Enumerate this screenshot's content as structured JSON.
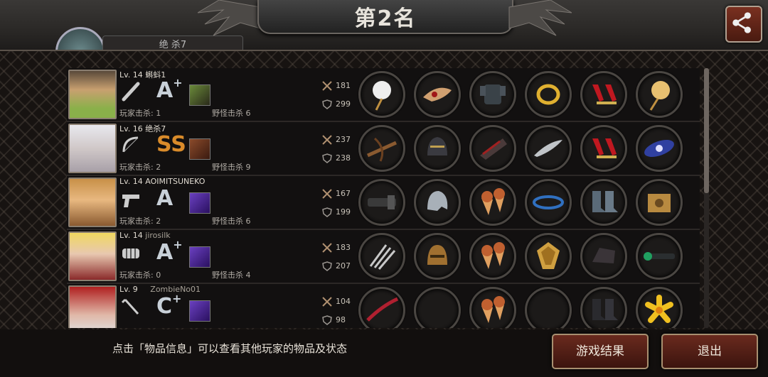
{
  "header": {
    "rank_title": "第2名",
    "tab_stub_text": "绝  杀7"
  },
  "icons": {
    "share": "share-icon",
    "attack": "crossed-swords-icon",
    "defense": "shield-icon"
  },
  "colors": {
    "button_bg": "#5a2218",
    "grade_ss": "#d98b2a",
    "grade_default": "#c8d0d8"
  },
  "players": [
    {
      "level": "Lv. 14",
      "nickname": "蝌蚪1",
      "weapon_icon": "baseball-bat-icon",
      "grade": "A",
      "grade_plus": "+",
      "skill_icon": "character-skill-icon",
      "player_kills": "玩家击杀: 1",
      "monster_kills": "野怪击杀 6",
      "attack": "181",
      "defense": "299",
      "items": [
        "paper-fan-icon",
        "winged-mask-icon",
        "body-armor-icon",
        "gold-ring-icon",
        "red-high-heels-icon",
        "portrait-fan-icon"
      ]
    },
    {
      "level": "Lv. 16",
      "nickname": "绝杀7",
      "weapon_icon": "bow-icon",
      "grade": "SS",
      "grade_plus": "",
      "skill_icon": "shuriken-skill-icon",
      "player_kills": "玩家击杀: 2",
      "monster_kills": "野怪击杀 9",
      "attack": "237",
      "defense": "238",
      "items": [
        "crossbow-icon",
        "knight-helmet-icon",
        "arm-guard-icon",
        "feather-blade-icon",
        "red-high-heels-icon",
        "galaxy-icon"
      ]
    },
    {
      "level": "Lv. 14",
      "nickname": "AOIMITSUNEKO",
      "weapon_icon": "pistol-icon",
      "grade": "A",
      "grade_plus": "",
      "skill_icon": "purple-beast-skill-icon",
      "player_kills": "玩家击杀: 2",
      "monster_kills": "野怪击杀 6",
      "attack": "167",
      "defense": "199",
      "items": [
        "minigun-icon",
        "steel-helmet-icon",
        "ice-cream-cones-icon",
        "blue-bead-necklace-icon",
        "metal-boots-icon",
        "supply-box-icon"
      ]
    },
    {
      "level": "Lv. 14",
      "nickname": "jirosilk",
      "weapon_icon": "brass-knuckles-icon",
      "grade": "A",
      "grade_plus": "+",
      "skill_icon": "purple-beast-skill-icon",
      "player_kills": "玩家击杀: 0",
      "monster_kills": "野怪击杀 4",
      "attack": "183",
      "defense": "207",
      "items": [
        "claw-blades-icon",
        "bronze-helmet-icon",
        "ice-cream-cones-icon",
        "gold-shield-icon",
        "gauntlet-icon",
        "sniper-scope-icon"
      ]
    },
    {
      "level": "Lv. 9",
      "nickname": "ZombieNo01",
      "weapon_icon": "crowbar-icon",
      "grade": "C",
      "grade_plus": "+",
      "skill_icon": "purple-beast-skill-icon",
      "player_kills": "",
      "monster_kills": "",
      "attack": "104",
      "defense": "98",
      "items": [
        "red-whip-icon",
        "empty-slot",
        "ice-cream-cones-icon",
        "empty-slot",
        "black-boots-icon",
        "yellow-lily-icon"
      ]
    }
  ],
  "footer": {
    "hint": "点击「物品信息」可以查看其他玩家的物品及状态",
    "result_button": "游戏结果",
    "exit_button": "退出"
  }
}
